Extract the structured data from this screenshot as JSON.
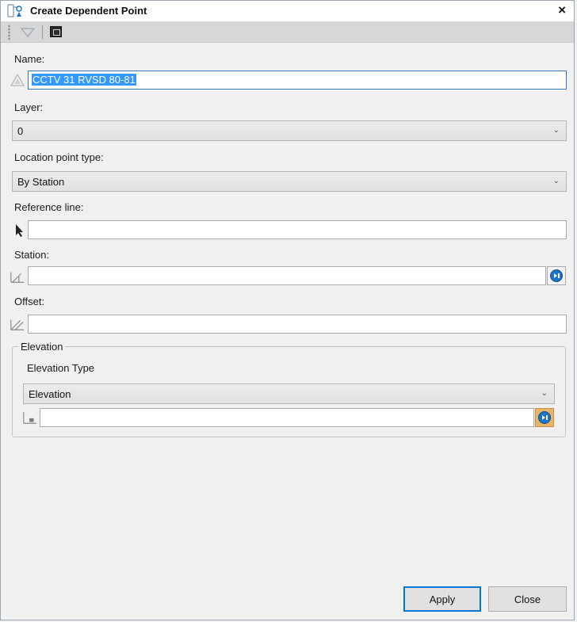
{
  "window": {
    "title": "Create Dependent Point",
    "close_glyph": "×"
  },
  "toolbar": {
    "items": [
      "filter-icon",
      "window-icon"
    ]
  },
  "fields": {
    "name": {
      "label": "Name:",
      "value": "CCTV 31 RVSD 80-81"
    },
    "layer": {
      "label": "Layer:",
      "value": "0"
    },
    "location_point_type": {
      "label": "Location point type:",
      "value": "By Station"
    },
    "reference_line": {
      "label": "Reference line:",
      "value": ""
    },
    "station": {
      "label": "Station:",
      "value": ""
    },
    "offset": {
      "label": "Offset:",
      "value": ""
    }
  },
  "elevation_group": {
    "title": "Elevation",
    "type_label": "Elevation Type",
    "type_value": "Elevation",
    "value": ""
  },
  "buttons": {
    "apply": "Apply",
    "close": "Close"
  },
  "colors": {
    "selection": "#3399ff",
    "focus_border": "#3b78c2",
    "pick_orange": "#e8b46a",
    "pick_disc": "#1f74c9"
  }
}
